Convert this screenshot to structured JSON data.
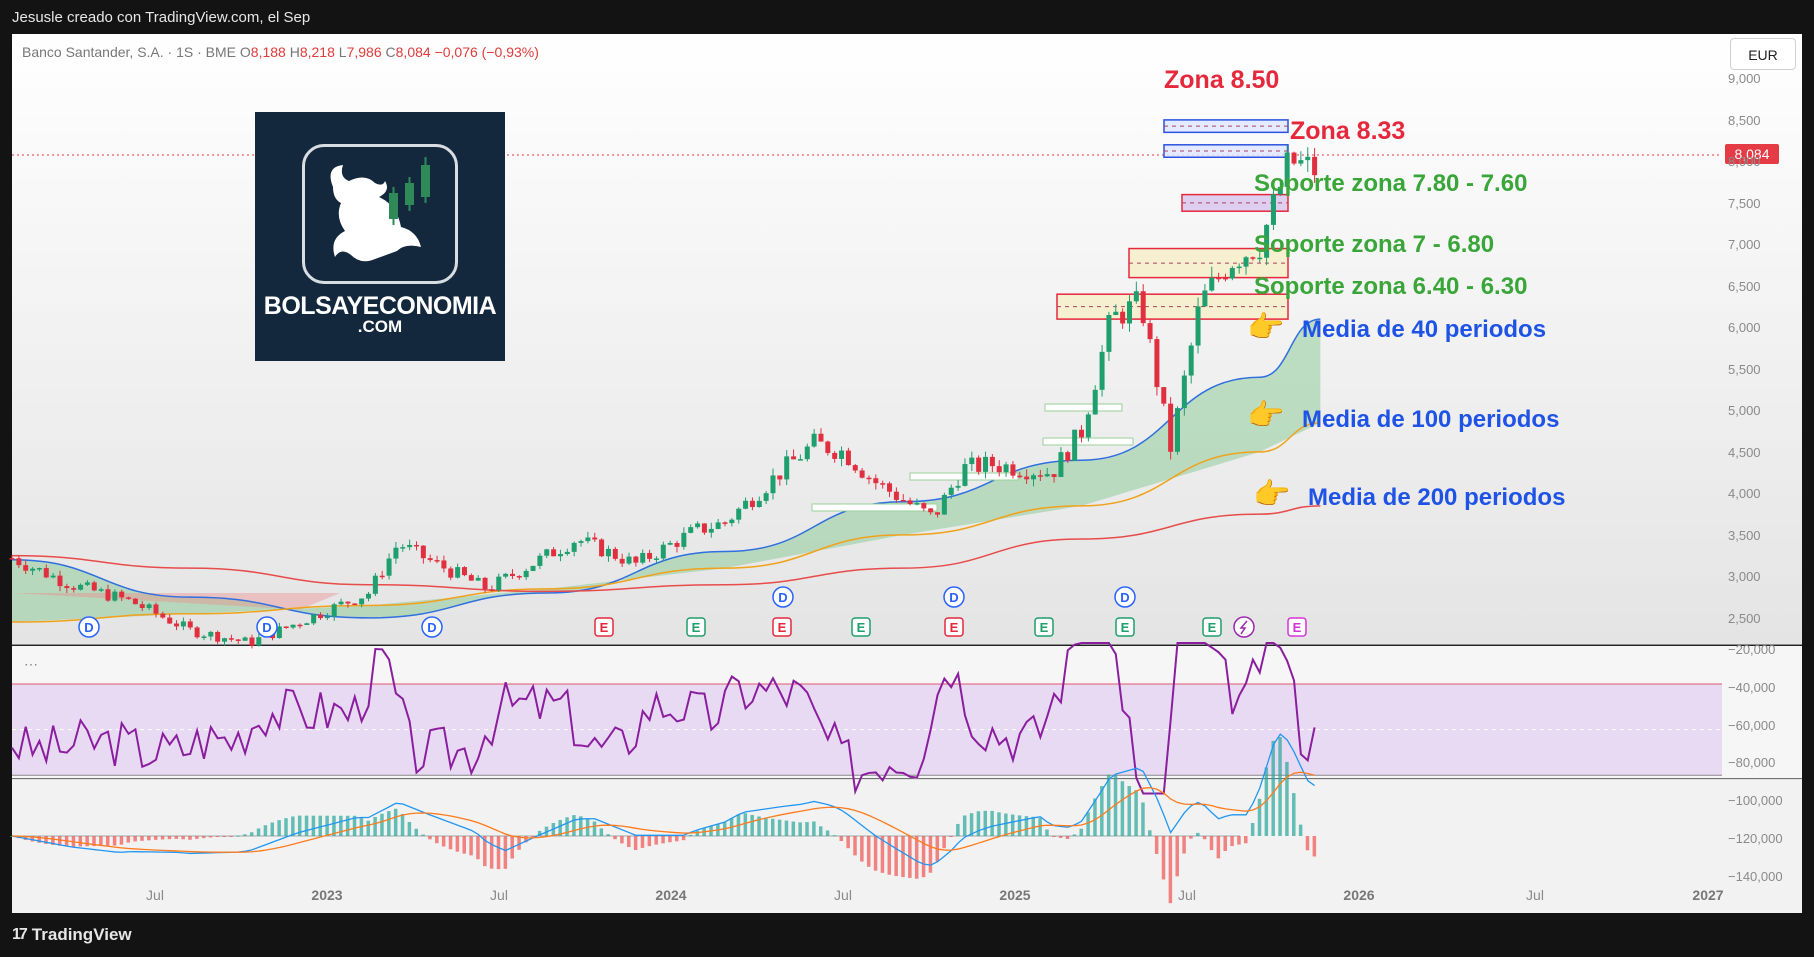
{
  "header": {
    "credit": "Jesusle creado con TradingView.com, el Sep"
  },
  "footer": {
    "brand": "TradingView"
  },
  "symbol": {
    "name": "Banco Santander, S.A. · 1S · BME",
    "open_label": "O",
    "open": "8,188",
    "high_label": "H",
    "high": "8,218",
    "low_label": "L",
    "low": "7,986",
    "close_label": "C",
    "close": "8,084",
    "change": "−0,076 (−0,93%)"
  },
  "currency_button": "EUR",
  "last_price_tag": "8,084",
  "logo": {
    "line1": "BOLSAYECONOMIA",
    "line2": ".COM"
  },
  "annotations": {
    "zona_850": "Zona 8.50",
    "zona_833": "Zona 8.33",
    "soporte_780": "Soporte zona 7.80 - 7.60",
    "soporte_700": "Soporte zona 7 - 6.80",
    "soporte_640": "Soporte zona 6.40 - 6.30",
    "media_40": "Media de 40 periodos",
    "media_100": "Media de 100 periodos",
    "media_200": "Media de 200 periodos"
  },
  "colors": {
    "up": "#1f9e6e",
    "down": "#e0303f",
    "ma40": "#2f6fe0",
    "ma100": "#f0a21a",
    "ma200": "#e84b4b",
    "rsi": "#8a1e9e",
    "macd": "#2196f3",
    "signal": "#ff7a1a"
  },
  "axes": {
    "price_ticks": [
      "9,000",
      "8,500",
      "8,000",
      "7,500",
      "7,000",
      "6,500",
      "6,000",
      "5,500",
      "5,000",
      "4,500",
      "4,000",
      "3,500",
      "3,000",
      "2,500"
    ],
    "indicator_ticks": [
      "−20,000",
      "−40,000",
      "−60,000",
      "−80,000",
      "−100,000",
      "−120,000",
      "−140,000"
    ],
    "time_ticks": [
      {
        "label": "Jul",
        "bold": false
      },
      {
        "label": "2023",
        "bold": true
      },
      {
        "label": "Jul",
        "bold": false
      },
      {
        "label": "2024",
        "bold": true
      },
      {
        "label": "Jul",
        "bold": false
      },
      {
        "label": "2025",
        "bold": true
      },
      {
        "label": "Jul",
        "bold": false
      },
      {
        "label": "2026",
        "bold": true
      },
      {
        "label": "Jul",
        "bold": false
      },
      {
        "label": "2027",
        "bold": true
      }
    ]
  },
  "event_markers": {
    "dividends": "D",
    "earnings": "E"
  },
  "chart_data": {
    "type": "candlestick",
    "title": "Banco Santander, S.A. · 1S · BME",
    "ylim": [
      2.3,
      9.2
    ],
    "x_range": [
      "2022-01",
      "2027-01"
    ],
    "series_close": [
      {
        "x": "2022-01",
        "y": 3.42
      },
      {
        "x": "2022-03",
        "y": 3.1
      },
      {
        "x": "2022-05",
        "y": 2.9
      },
      {
        "x": "2022-07",
        "y": 2.55
      },
      {
        "x": "2022-09",
        "y": 2.4
      },
      {
        "x": "2022-11",
        "y": 2.7
      },
      {
        "x": "2023-01",
        "y": 3.0
      },
      {
        "x": "2023-02",
        "y": 3.6
      },
      {
        "x": "2023-03",
        "y": 3.4
      },
      {
        "x": "2023-05",
        "y": 3.05
      },
      {
        "x": "2023-07",
        "y": 3.45
      },
      {
        "x": "2023-08",
        "y": 3.65
      },
      {
        "x": "2023-10",
        "y": 3.35
      },
      {
        "x": "2023-12",
        "y": 3.75
      },
      {
        "x": "2024-01",
        "y": 3.85
      },
      {
        "x": "2024-03",
        "y": 4.5
      },
      {
        "x": "2024-04",
        "y": 4.8
      },
      {
        "x": "2024-05",
        "y": 4.7
      },
      {
        "x": "2024-06",
        "y": 4.35
      },
      {
        "x": "2024-08",
        "y": 3.9
      },
      {
        "x": "2024-09",
        "y": 4.5
      },
      {
        "x": "2024-10",
        "y": 4.55
      },
      {
        "x": "2024-12",
        "y": 4.45
      },
      {
        "x": "2025-01",
        "y": 4.95
      },
      {
        "x": "2025-02",
        "y": 6.3
      },
      {
        "x": "2025-03",
        "y": 6.5
      },
      {
        "x": "2025-04",
        "y": 4.75
      },
      {
        "x": "2025-05",
        "y": 6.5
      },
      {
        "x": "2025-06",
        "y": 7.0
      },
      {
        "x": "2025-07",
        "y": 7.2
      },
      {
        "x": "2025-08",
        "y": 8.2
      },
      {
        "x": "2025-09",
        "y": 8.08
      }
    ],
    "moving_averages": [
      {
        "name": "Media de 40 periodos",
        "points": [
          [
            2022.0,
            3.4
          ],
          [
            2022.5,
            2.95
          ],
          [
            2023.0,
            2.7
          ],
          [
            2023.5,
            3.0
          ],
          [
            2024.0,
            3.5
          ],
          [
            2024.5,
            4.1
          ],
          [
            2025.0,
            4.6
          ],
          [
            2025.5,
            5.6
          ],
          [
            2025.67,
            6.3
          ]
        ]
      },
      {
        "name": "Media de 100 periodos",
        "points": [
          [
            2022.0,
            2.65
          ],
          [
            2022.5,
            2.75
          ],
          [
            2023.0,
            2.85
          ],
          [
            2023.5,
            3.05
          ],
          [
            2024.0,
            3.3
          ],
          [
            2024.5,
            3.7
          ],
          [
            2025.0,
            4.05
          ],
          [
            2025.5,
            4.7
          ],
          [
            2025.67,
            5.05
          ]
        ]
      },
      {
        "name": "Media de 200 periodos",
        "points": [
          [
            2022.0,
            3.45
          ],
          [
            2022.5,
            3.3
          ],
          [
            2023.0,
            3.1
          ],
          [
            2023.5,
            3.02
          ],
          [
            2024.0,
            3.1
          ],
          [
            2024.5,
            3.3
          ],
          [
            2025.0,
            3.65
          ],
          [
            2025.5,
            3.95
          ],
          [
            2025.67,
            4.05
          ]
        ]
      }
    ],
    "zones": [
      {
        "label": "Zona 8.50",
        "low": 8.55,
        "high": 8.7,
        "color": "blue"
      },
      {
        "label": "Zona 8.33",
        "low": 8.25,
        "high": 8.4,
        "color": "blue"
      },
      {
        "label": "Soporte zona 7.80 - 7.60",
        "low": 7.6,
        "high": 7.8,
        "color": "red"
      },
      {
        "label": "Soporte zona 7 - 6.80",
        "low": 6.8,
        "high": 7.15,
        "color": "red"
      },
      {
        "label": "Soporte zona 6.40 - 6.30",
        "low": 6.3,
        "high": 6.6,
        "color": "red"
      }
    ],
    "last_price": 8.084
  }
}
